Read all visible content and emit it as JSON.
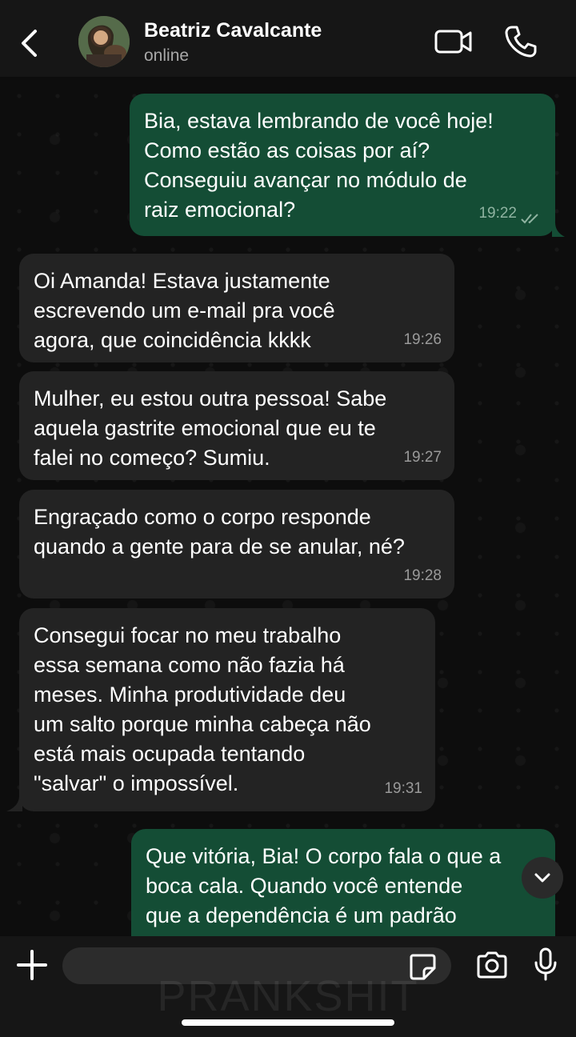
{
  "header": {
    "contact_name": "Beatriz Cavalcante",
    "status": "online",
    "icons": [
      "back-chevron-icon",
      "avatar",
      "video-camera-icon",
      "phone-icon"
    ]
  },
  "watermark": "PRANKSHIT",
  "messages": [
    {
      "direction": "out",
      "text": "Bia, estava lembrando de você hoje!\nComo estão as coisas por aí?\nConseguiu avançar no módulo de\nraiz emocional?",
      "time": "19:22",
      "status": "read"
    },
    {
      "direction": "in",
      "text": "Oi Amanda! Estava justamente\nescrevendo um e-mail pra você\nagora, que coincidência kkkk",
      "time": "19:26"
    },
    {
      "direction": "in",
      "text": "Mulher, eu estou outra pessoa! Sabe\naquela gastrite emocional que eu te\nfalei no começo? Sumiu.",
      "time": "19:27"
    },
    {
      "direction": "in",
      "text": "Engraçado como o corpo responde\nquando a gente para de se anular, né?",
      "time": "19:28"
    },
    {
      "direction": "in",
      "text": "Consegui focar no meu trabalho\nessa semana como não fazia há\nmeses. Minha produtividade deu\num salto porque minha cabeça não\nestá mais ocupada tentando\n\"salvar\" o impossível.",
      "time": "19:31"
    },
    {
      "direction": "out",
      "text": "Que vitória, Bia! O corpo fala o que a\nboca cala. Quando você entende\nque a dependência é um padrão",
      "time": ""
    }
  ],
  "composer": {
    "placeholder": "",
    "icons": [
      "plus-icon",
      "sticker-icon",
      "camera-icon",
      "microphone-icon"
    ]
  },
  "colors": {
    "outgoing_bubble": "#144d35",
    "incoming_bubble": "#232323",
    "header_bg": "#161616",
    "chat_bg": "#0d0d0d"
  }
}
